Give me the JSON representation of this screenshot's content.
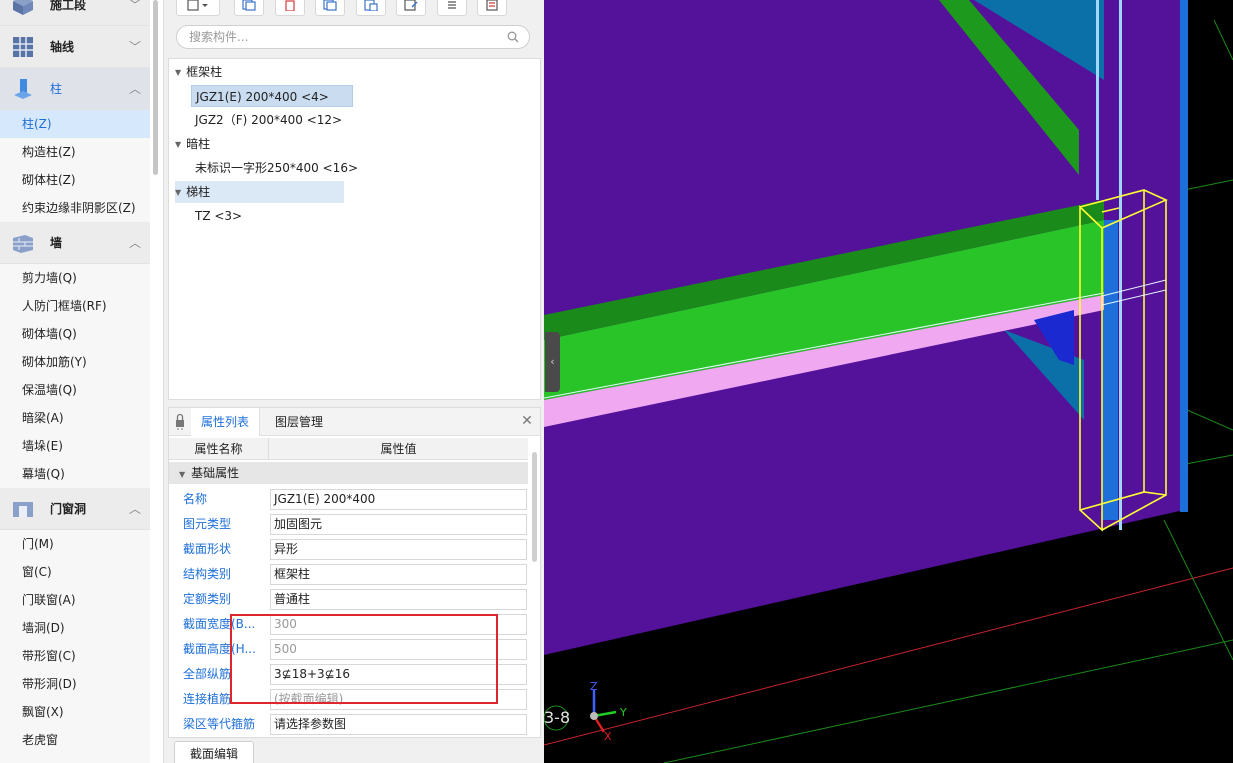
{
  "nav": {
    "categories": [
      {
        "label": "施工段",
        "icon": "construction-section-icon"
      },
      {
        "label": "轴线",
        "icon": "axis-grid-icon"
      },
      {
        "label": "柱",
        "icon": "column-icon"
      },
      {
        "label": "墙",
        "icon": "wall-icon"
      },
      {
        "label": "门窗洞",
        "icon": "door-window-icon"
      }
    ],
    "column_items": [
      "柱(Z)",
      "构造柱(Z)",
      "砌体柱(Z)",
      "约束边缘非阴影区(Z)"
    ],
    "wall_items": [
      "剪力墙(Q)",
      "人防门框墙(RF)",
      "砌体墙(Q)",
      "砌体加筋(Y)",
      "保温墙(Q)",
      "暗梁(A)",
      "墙垛(E)",
      "幕墙(Q)"
    ],
    "opening_items": [
      "门(M)",
      "窗(C)",
      "门联窗(A)",
      "墙洞(D)",
      "带形窗(C)",
      "带形洞(D)",
      "飘窗(X)",
      "老虎窗"
    ]
  },
  "search": {
    "placeholder": "搜索构件..."
  },
  "tree": {
    "groups": [
      {
        "label": "框架柱",
        "children": [
          "JGZ1(E) 200*400 <4>",
          "JGZ2（F) 200*400 <12>"
        ]
      },
      {
        "label": "暗柱",
        "children": [
          "未标识一字形250*400 <16>"
        ]
      },
      {
        "label": "梯柱",
        "children": [
          "TZ <3>"
        ]
      }
    ]
  },
  "props": {
    "tab_active": "属性列表",
    "tab_other": "图层管理",
    "col_name": "属性名称",
    "col_value": "属性值",
    "group": "基础属性",
    "rows": [
      {
        "name": "名称",
        "value": "JGZ1(E) 200*400"
      },
      {
        "name": "图元类型",
        "value": "加固图元"
      },
      {
        "name": "截面形状",
        "value": "异形"
      },
      {
        "name": "结构类别",
        "value": "框架柱"
      },
      {
        "name": "定额类别",
        "value": "普通柱"
      },
      {
        "name": "截面宽度(B...",
        "value": "300"
      },
      {
        "name": "截面高度(H...",
        "value": "500"
      },
      {
        "name": "全部纵筋",
        "value": "3⊈18+3⊈16"
      },
      {
        "name": "连接植筋",
        "value": "(按截面编辑)"
      },
      {
        "name": "梁区等代箍筋",
        "value": "请选择参数图"
      }
    ]
  },
  "bottom_tab": "截面编辑",
  "viewport": {
    "axis_label": "3-8",
    "axes": {
      "x": "X",
      "y": "Y",
      "z": "Z"
    },
    "colors": {
      "background": "#000000",
      "wall": "#5a0fa0",
      "beam": "#2ec42e",
      "selection": "#ffff33",
      "column": "#1e6fd9"
    }
  }
}
